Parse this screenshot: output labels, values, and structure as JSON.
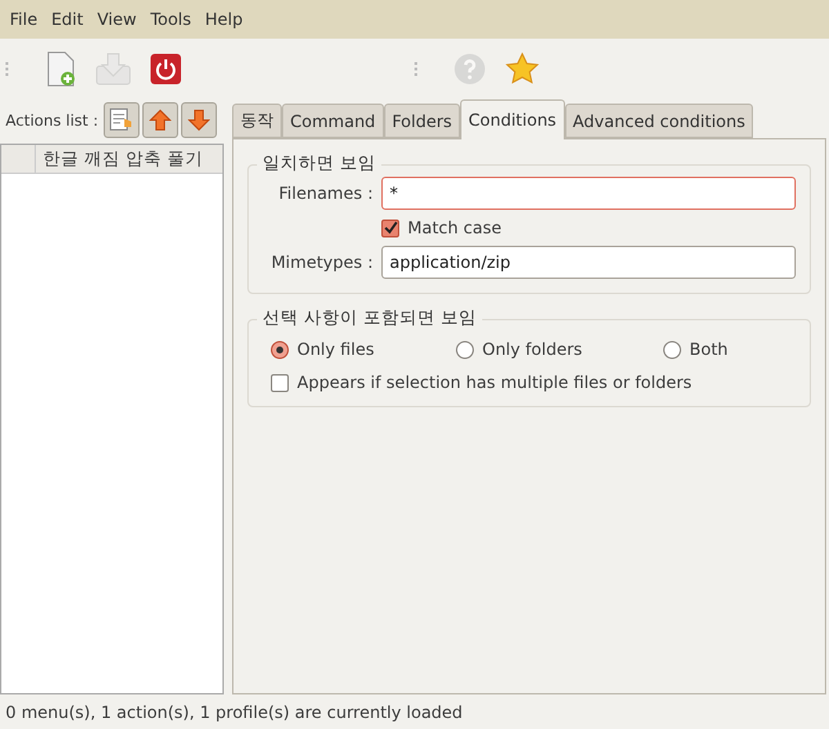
{
  "menu": [
    "File",
    "Edit",
    "View",
    "Tools",
    "Help"
  ],
  "toolbar": {
    "left": [
      {
        "kind": "new",
        "disabled": false
      },
      {
        "kind": "save",
        "disabled": true
      },
      {
        "kind": "quit",
        "disabled": false
      }
    ],
    "right": [
      {
        "kind": "help",
        "disabled": true
      },
      {
        "kind": "about",
        "disabled": false
      }
    ]
  },
  "actions_list": {
    "label": "Actions list :",
    "buttons": [
      {
        "kind": "edit"
      },
      {
        "kind": "up"
      },
      {
        "kind": "down"
      }
    ]
  },
  "tree": {
    "column_header": "한글 깨짐 압축 풀기"
  },
  "tabs": [
    {
      "label": "동작",
      "selected": false
    },
    {
      "label": "Command",
      "selected": false
    },
    {
      "label": "Folders",
      "selected": false
    },
    {
      "label": "Conditions",
      "selected": true
    },
    {
      "label": "Advanced conditions",
      "selected": false
    }
  ],
  "match_group": {
    "title": "일치하면 보임",
    "filenames_label": "Filenames :",
    "filenames_value": "*",
    "filenames_focused": true,
    "match_case": {
      "label": "Match case",
      "checked": true
    },
    "mimetypes_label": "Mimetypes :",
    "mimetypes_value": "application/zip"
  },
  "selection_group": {
    "title": "선택 사항이 포함되면 보임",
    "radios": [
      {
        "label": "Only files",
        "selected": true
      },
      {
        "label": "Only folders",
        "selected": false
      },
      {
        "label": "Both",
        "selected": false
      }
    ],
    "multiple": {
      "label": "Appears if selection has multiple files or folders",
      "checked": false
    }
  },
  "status_bar": "0 menu(s), 1 action(s), 1 profile(s) are currently loaded"
}
